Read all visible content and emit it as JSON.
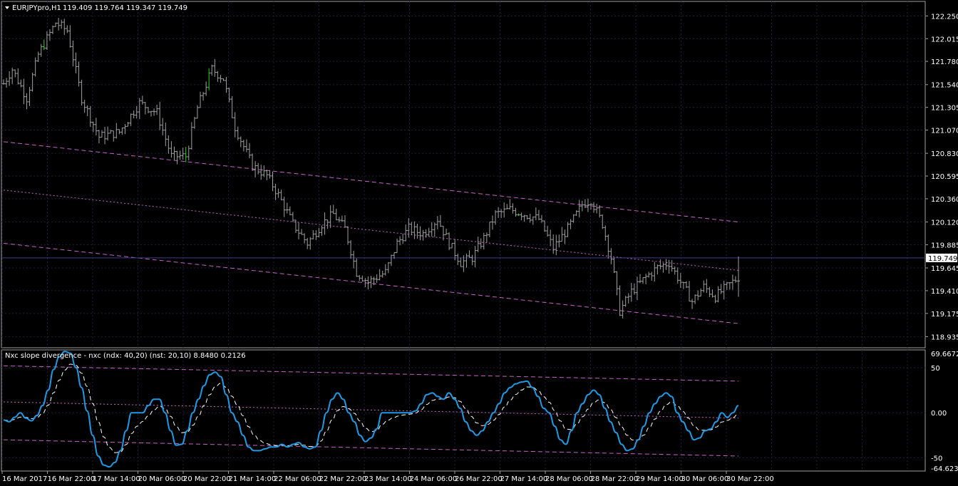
{
  "window": {
    "symbol_title": "EURJPYpro,H1",
    "ohlc": "119.409 119.764 119.347 119.749"
  },
  "indicator": {
    "title": "Nxc slope divergence - nxc (ndx: 40,20) (nst: 20,10) 8.8480 0.2126"
  },
  "colors": {
    "background": "#000000",
    "grid": "#1e1e3c",
    "candle": "#a0a0a0",
    "bull_tick": "#32cd32",
    "channel": "#c864c8",
    "osc_main": "#1e9be6",
    "osc_signal": "#ffffff",
    "bid_line": "#3c3c8c",
    "axis_text": "#ffffff"
  },
  "chart_data": [
    {
      "type": "candlestick",
      "title": "EURJPYpro,H1",
      "ylim": [
        118.82,
        122.4
      ],
      "y_ticks": [
        "122.250",
        "122.015",
        "121.780",
        "121.540",
        "121.305",
        "121.070",
        "120.830",
        "120.595",
        "120.360",
        "120.120",
        "119.885",
        "119.645",
        "119.410",
        "119.175",
        "118.935"
      ],
      "current_price": "119.749",
      "x_ticks": [
        "16 Mar 2017",
        "16 Mar 22:00",
        "17 Mar 14:00",
        "20 Mar 06:00",
        "20 Mar 22:00",
        "21 Mar 14:00",
        "22 Mar 06:00",
        "22 Mar 22:00",
        "23 Mar 14:00",
        "24 Mar 06:00",
        "26 Mar 22:00",
        "27 Mar 14:00",
        "28 Mar 06:00",
        "28 Mar 22:00",
        "29 Mar 14:00",
        "30 Mar 06:00",
        "30 Mar 22:00"
      ],
      "path_keypoints": [
        {
          "bar": 0,
          "price": 121.55
        },
        {
          "bar": 3,
          "price": 121.7
        },
        {
          "bar": 8,
          "price": 121.4
        },
        {
          "bar": 12,
          "price": 121.85
        },
        {
          "bar": 18,
          "price": 122.18
        },
        {
          "bar": 22,
          "price": 122.1
        },
        {
          "bar": 27,
          "price": 121.4
        },
        {
          "bar": 33,
          "price": 121.0
        },
        {
          "bar": 40,
          "price": 121.05
        },
        {
          "bar": 47,
          "price": 121.35
        },
        {
          "bar": 53,
          "price": 121.25
        },
        {
          "bar": 58,
          "price": 120.8
        },
        {
          "bar": 63,
          "price": 120.8
        },
        {
          "bar": 67,
          "price": 121.3
        },
        {
          "bar": 72,
          "price": 121.7
        },
        {
          "bar": 76,
          "price": 121.6
        },
        {
          "bar": 80,
          "price": 121.1
        },
        {
          "bar": 86,
          "price": 120.7
        },
        {
          "bar": 91,
          "price": 120.6
        },
        {
          "bar": 95,
          "price": 120.4
        },
        {
          "bar": 100,
          "price": 120.1
        },
        {
          "bar": 105,
          "price": 119.9
        },
        {
          "bar": 110,
          "price": 120.1
        },
        {
          "bar": 114,
          "price": 120.2
        },
        {
          "bar": 118,
          "price": 120.05
        },
        {
          "bar": 122,
          "price": 119.6
        },
        {
          "bar": 126,
          "price": 119.5
        },
        {
          "bar": 132,
          "price": 119.6
        },
        {
          "bar": 136,
          "price": 119.9
        },
        {
          "bar": 140,
          "price": 120.05
        },
        {
          "bar": 145,
          "price": 120.0
        },
        {
          "bar": 150,
          "price": 120.15
        },
        {
          "bar": 154,
          "price": 119.9
        },
        {
          "bar": 158,
          "price": 119.7
        },
        {
          "bar": 162,
          "price": 119.75
        },
        {
          "bar": 166,
          "price": 119.95
        },
        {
          "bar": 170,
          "price": 120.2
        },
        {
          "bar": 175,
          "price": 120.25
        },
        {
          "bar": 180,
          "price": 120.2
        },
        {
          "bar": 185,
          "price": 120.15
        },
        {
          "bar": 190,
          "price": 119.85
        },
        {
          "bar": 195,
          "price": 120.05
        },
        {
          "bar": 200,
          "price": 120.3
        },
        {
          "bar": 203,
          "price": 120.35
        },
        {
          "bar": 207,
          "price": 120.1
        },
        {
          "bar": 210,
          "price": 119.75
        },
        {
          "bar": 213,
          "price": 119.2
        },
        {
          "bar": 217,
          "price": 119.4
        },
        {
          "bar": 222,
          "price": 119.55
        },
        {
          "bar": 226,
          "price": 119.65
        },
        {
          "bar": 230,
          "price": 119.7
        },
        {
          "bar": 234,
          "price": 119.5
        },
        {
          "bar": 238,
          "price": 119.3
        },
        {
          "bar": 242,
          "price": 119.45
        },
        {
          "bar": 246,
          "price": 119.35
        },
        {
          "bar": 250,
          "price": 119.45
        },
        {
          "bar": 254,
          "price": 119.55
        }
      ],
      "total_bars": 255,
      "channel": {
        "upper": [
          {
            "bar": 0,
            "price": 120.95
          },
          {
            "bar": 254,
            "price": 120.12
          }
        ],
        "middle": [
          {
            "bar": 0,
            "price": 120.45
          },
          {
            "bar": 254,
            "price": 119.62
          }
        ],
        "lower": [
          {
            "bar": 0,
            "price": 119.9
          },
          {
            "bar": 254,
            "price": 119.07
          }
        ]
      }
    },
    {
      "type": "line",
      "title": "Nxc slope divergence - nxc (ndx: 40,20) (nst: 20,10) 8.8480 0.2126",
      "ylim": [
        -64.6236,
        69.6672
      ],
      "y_ticks": [
        "69.6672",
        "50",
        "0.00",
        "-50",
        "-64.6236"
      ],
      "series": [
        {
          "name": "nxc",
          "values": [
            -8,
            -10,
            -5,
            0,
            -6,
            -9,
            -3,
            8,
            25,
            48,
            62,
            68,
            66,
            50,
            28,
            2,
            -25,
            -48,
            -58,
            -60,
            -55,
            -42,
            -20,
            0,
            0,
            0,
            8,
            15,
            15,
            0,
            -20,
            -36,
            -35,
            -20,
            0,
            15,
            30,
            42,
            45,
            40,
            20,
            0,
            -10,
            -25,
            -38,
            -42,
            -42,
            -40,
            -38,
            -38,
            -35,
            -38,
            -35,
            -33,
            -38,
            -40,
            -38,
            -20,
            0,
            15,
            22,
            15,
            0,
            -10,
            -25,
            -32,
            -28,
            -18,
            0,
            0,
            0,
            0,
            0,
            0,
            2,
            10,
            20,
            22,
            18,
            15,
            22,
            15,
            5,
            -10,
            -20,
            -25,
            -20,
            -10,
            0,
            10,
            22,
            28,
            32,
            34,
            35,
            28,
            18,
            5,
            0,
            -15,
            -30,
            -35,
            -20,
            0,
            10,
            20,
            25,
            20,
            5,
            -10,
            -22,
            -35,
            -42,
            -40,
            -30,
            -15,
            0,
            10,
            18,
            22,
            18,
            0,
            -10,
            -20,
            -30,
            -28,
            -20,
            -18,
            -10,
            0,
            -5,
            0,
            8
          ]
        }
      ],
      "channel": {
        "upper": [
          {
            "t": 0,
            "v": 52
          },
          {
            "t": 1,
            "v": 35
          }
        ],
        "middle": [
          {
            "t": 0,
            "v": 12
          },
          {
            "t": 1,
            "v": -6
          }
        ],
        "lower": [
          {
            "t": 0,
            "v": -30
          },
          {
            "t": 1,
            "v": -48
          }
        ]
      }
    }
  ]
}
